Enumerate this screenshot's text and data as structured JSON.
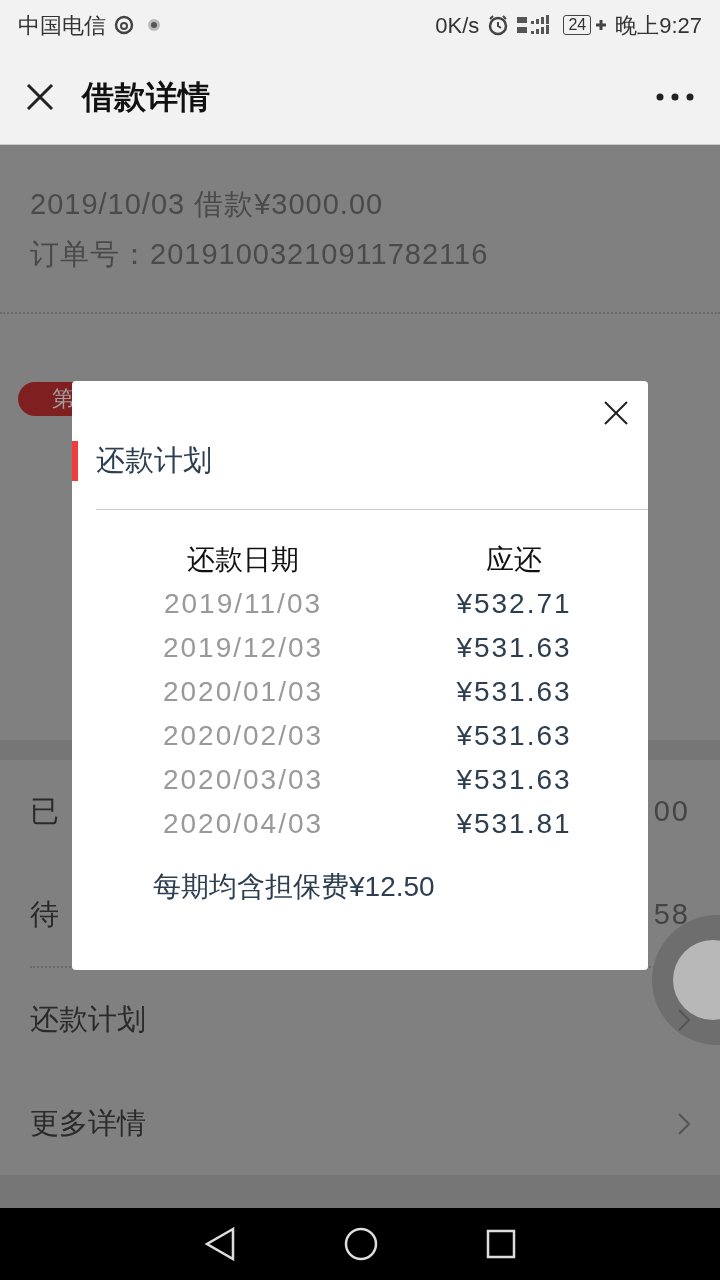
{
  "status_bar": {
    "carrier": "中国电信",
    "speed": "0K/s",
    "battery": "24",
    "time": "晚上9:27"
  },
  "header": {
    "title": "借款详情"
  },
  "loan": {
    "summary": "2019/10/03 借款¥3000.00",
    "order": "订单号：20191003210911782116"
  },
  "badge": {
    "text": "第"
  },
  "rows": [
    {
      "label": "已",
      "value": "00"
    },
    {
      "label": "待",
      "value": "58"
    }
  ],
  "links": [
    {
      "label": "还款计划"
    },
    {
      "label": "更多详情"
    }
  ],
  "dialog": {
    "title": "还款计划",
    "columns": [
      "还款日期",
      "应还"
    ],
    "rows": [
      {
        "date": "2019/11/03",
        "amount": "¥532.71"
      },
      {
        "date": "2019/12/03",
        "amount": "¥531.63"
      },
      {
        "date": "2020/01/03",
        "amount": "¥531.63"
      },
      {
        "date": "2020/02/03",
        "amount": "¥531.63"
      },
      {
        "date": "2020/03/03",
        "amount": "¥531.63"
      },
      {
        "date": "2020/04/03",
        "amount": "¥531.81"
      }
    ],
    "note": "每期均含担保费¥12.50"
  }
}
